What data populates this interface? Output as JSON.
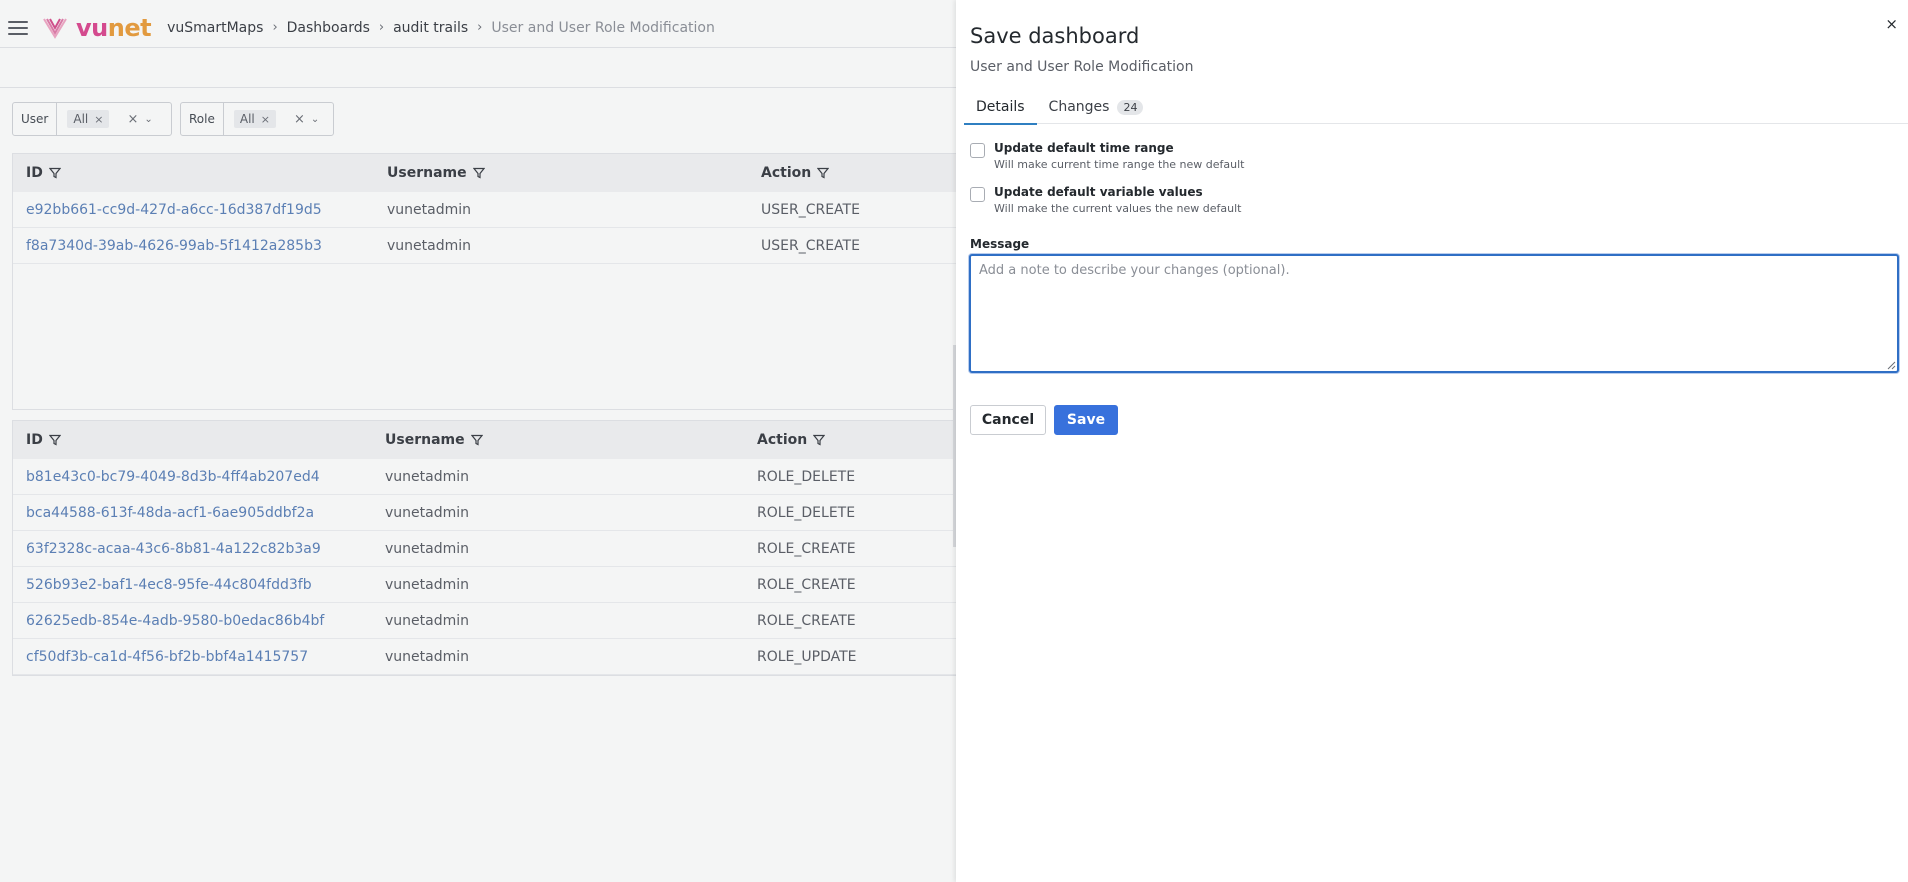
{
  "header": {
    "brand": {
      "part1": "vu",
      "part2": "net"
    },
    "breadcrumb": [
      "vuSmartMaps",
      "Dashboards",
      "audit trails",
      "User and User Role Modification"
    ],
    "separator": "›"
  },
  "filters": [
    {
      "label": "User",
      "value": "All"
    },
    {
      "label": "Role",
      "value": "All"
    }
  ],
  "icons": {
    "chip_remove": "×",
    "clear": "×",
    "dropdown": "⌄",
    "close": "×"
  },
  "table1": {
    "columns": [
      "ID",
      "Username",
      "Action"
    ],
    "rows": [
      [
        "e92bb661-cc9d-427d-a6cc-16d387df19d5",
        "vunetadmin",
        "USER_CREATE"
      ],
      [
        "f8a7340d-39ab-4626-99ab-5f1412a285b3",
        "vunetadmin",
        "USER_CREATE"
      ]
    ]
  },
  "table2": {
    "columns": [
      "ID",
      "Username",
      "Action"
    ],
    "rows": [
      [
        "b81e43c0-bc79-4049-8d3b-4ff4ab207ed4",
        "vunetadmin",
        "ROLE_DELETE"
      ],
      [
        "bca44588-613f-48da-acf1-6ae905ddbf2a",
        "vunetadmin",
        "ROLE_DELETE"
      ],
      [
        "63f2328c-acaa-43c6-8b81-4a122c82b3a9",
        "vunetadmin",
        "ROLE_CREATE"
      ],
      [
        "526b93e2-baf1-4ec8-95fe-44c804fdd3fb",
        "vunetadmin",
        "ROLE_CREATE"
      ],
      [
        "62625edb-854e-4adb-9580-b0edac86b4bf",
        "vunetadmin",
        "ROLE_CREATE"
      ],
      [
        "cf50df3b-ca1d-4f56-bf2b-bbf4a1415757",
        "vunetadmin",
        "ROLE_UPDATE"
      ]
    ]
  },
  "drawer": {
    "title": "Save dashboard",
    "subtitle": "User and User Role Modification",
    "tabs": [
      {
        "label": "Details",
        "active": true
      },
      {
        "label": "Changes",
        "badge": "24",
        "active": false
      }
    ],
    "options": [
      {
        "title": "Update default time range",
        "desc": "Will make current time range the new default"
      },
      {
        "title": "Update default variable values",
        "desc": "Will make the current values the new default"
      }
    ],
    "message_label": "Message",
    "message_placeholder": "Add a note to describe your changes (optional).",
    "message_value": "",
    "cancel_label": "Cancel",
    "save_label": "Save"
  },
  "colors": {
    "accent": "#3871dc",
    "link": "#5b7fb4",
    "brand_pink": "#d44a8e",
    "brand_orange": "#e29a3f"
  }
}
